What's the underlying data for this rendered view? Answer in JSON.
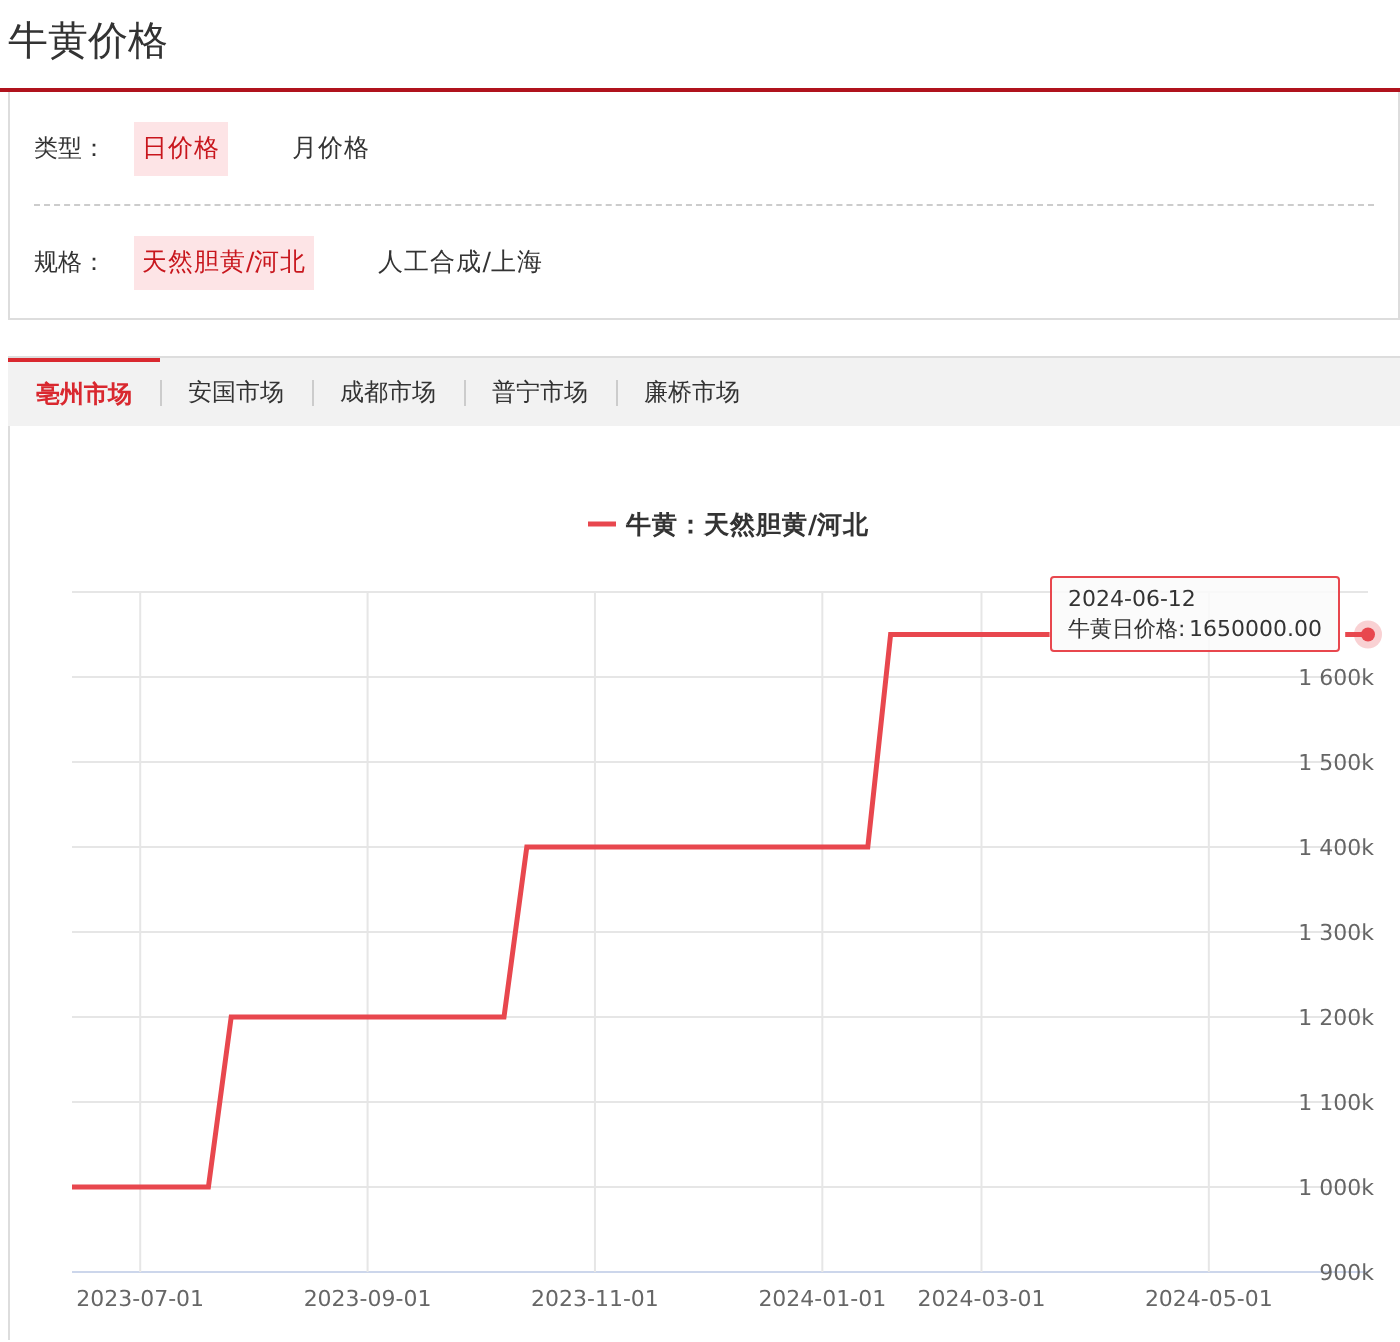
{
  "page_title": "牛黄价格",
  "filters": [
    {
      "label": "类型：",
      "options": [
        {
          "text": "日价格",
          "selected": true
        },
        {
          "text": "月价格",
          "selected": false
        }
      ]
    },
    {
      "label": "规格：",
      "options": [
        {
          "text": "天然胆黄/河北",
          "selected": true
        },
        {
          "text": "人工合成/上海",
          "selected": false
        }
      ]
    }
  ],
  "tabs": [
    {
      "label": "亳州市场",
      "selected": true
    },
    {
      "label": "安国市场",
      "selected": false
    },
    {
      "label": "成都市场",
      "selected": false
    },
    {
      "label": "普宁市场",
      "selected": false
    },
    {
      "label": "廉桥市场",
      "selected": false
    }
  ],
  "chart": {
    "chart_data": {
      "type": "line",
      "grid": true,
      "ylim": [
        900000,
        1700000
      ],
      "categories": [
        null,
        null,
        null,
        "2023-07-01",
        null,
        null,
        null,
        null,
        null,
        null,
        null,
        null,
        null,
        "2023-09-01",
        null,
        null,
        null,
        null,
        null,
        null,
        null,
        null,
        null,
        "2023-11-01",
        null,
        null,
        null,
        null,
        null,
        null,
        null,
        null,
        null,
        "2024-01-01",
        null,
        null,
        null,
        null,
        null,
        null,
        "2024-03-01",
        null,
        null,
        null,
        null,
        null,
        null,
        null,
        null,
        null,
        "2024-05-01",
        null,
        null,
        null,
        null,
        null,
        null,
        null
      ],
      "yticks": [
        {
          "value": 900000,
          "label": "900k"
        },
        {
          "value": 1000000,
          "label": "1 000k"
        },
        {
          "value": 1100000,
          "label": "1 100k"
        },
        {
          "value": 1200000,
          "label": "1 200k"
        },
        {
          "value": 1300000,
          "label": "1 300k"
        },
        {
          "value": 1400000,
          "label": "1 400k"
        },
        {
          "value": 1500000,
          "label": "1 500k"
        },
        {
          "value": 1600000,
          "label": "1 600k"
        }
      ],
      "series": [
        {
          "name": "牛黄：天然胆黄/河北",
          "color": "#e8474e",
          "values": [
            1000000,
            1000000,
            1000000,
            1000000,
            1000000,
            1000000,
            1000000,
            1200000,
            1200000,
            1200000,
            1200000,
            1200000,
            1200000,
            1200000,
            1200000,
            1200000,
            1200000,
            1200000,
            1200000,
            1200000,
            1400000,
            1400000,
            1400000,
            1400000,
            1400000,
            1400000,
            1400000,
            1400000,
            1400000,
            1400000,
            1400000,
            1400000,
            1400000,
            1400000,
            1400000,
            1400000,
            1650000,
            1650000,
            1650000,
            1650000,
            1650000,
            1650000,
            1650000,
            1650000,
            null,
            null,
            null,
            null,
            null,
            null,
            null,
            null,
            null,
            null,
            null,
            null,
            1650000,
            1650000
          ]
        }
      ]
    },
    "tooltip": {
      "date": "2024-06-12",
      "label": "牛黄日价格:",
      "value": "1650000.00"
    }
  }
}
